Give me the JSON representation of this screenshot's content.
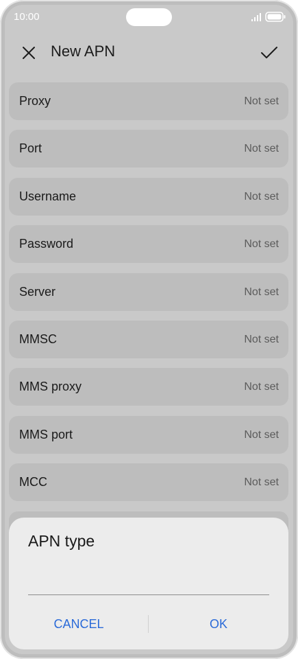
{
  "status_bar": {
    "time": "10:00",
    "icons": [
      "signal-icon",
      "battery-icon"
    ]
  },
  "app_bar": {
    "title": "New APN",
    "close_icon": "close-icon",
    "confirm_icon": "check-icon"
  },
  "settings": [
    {
      "label": "Proxy",
      "value": "Not set"
    },
    {
      "label": "Port",
      "value": "Not set"
    },
    {
      "label": "Username",
      "value": "Not set"
    },
    {
      "label": "Password",
      "value": "Not set"
    },
    {
      "label": "Server",
      "value": "Not set"
    },
    {
      "label": "MMSC",
      "value": "Not set"
    },
    {
      "label": "MMS proxy",
      "value": "Not set"
    },
    {
      "label": "MMS port",
      "value": "Not set"
    },
    {
      "label": "MCC",
      "value": "Not set"
    }
  ],
  "dialog": {
    "title": "APN type",
    "input_value": "",
    "cancel_label": "CANCEL",
    "ok_label": "OK"
  },
  "colors": {
    "accent": "#2a6ad8",
    "scrim_background": "#c9c9c9",
    "row_background": "#bdbdbd",
    "dialog_background": "#ececec"
  }
}
